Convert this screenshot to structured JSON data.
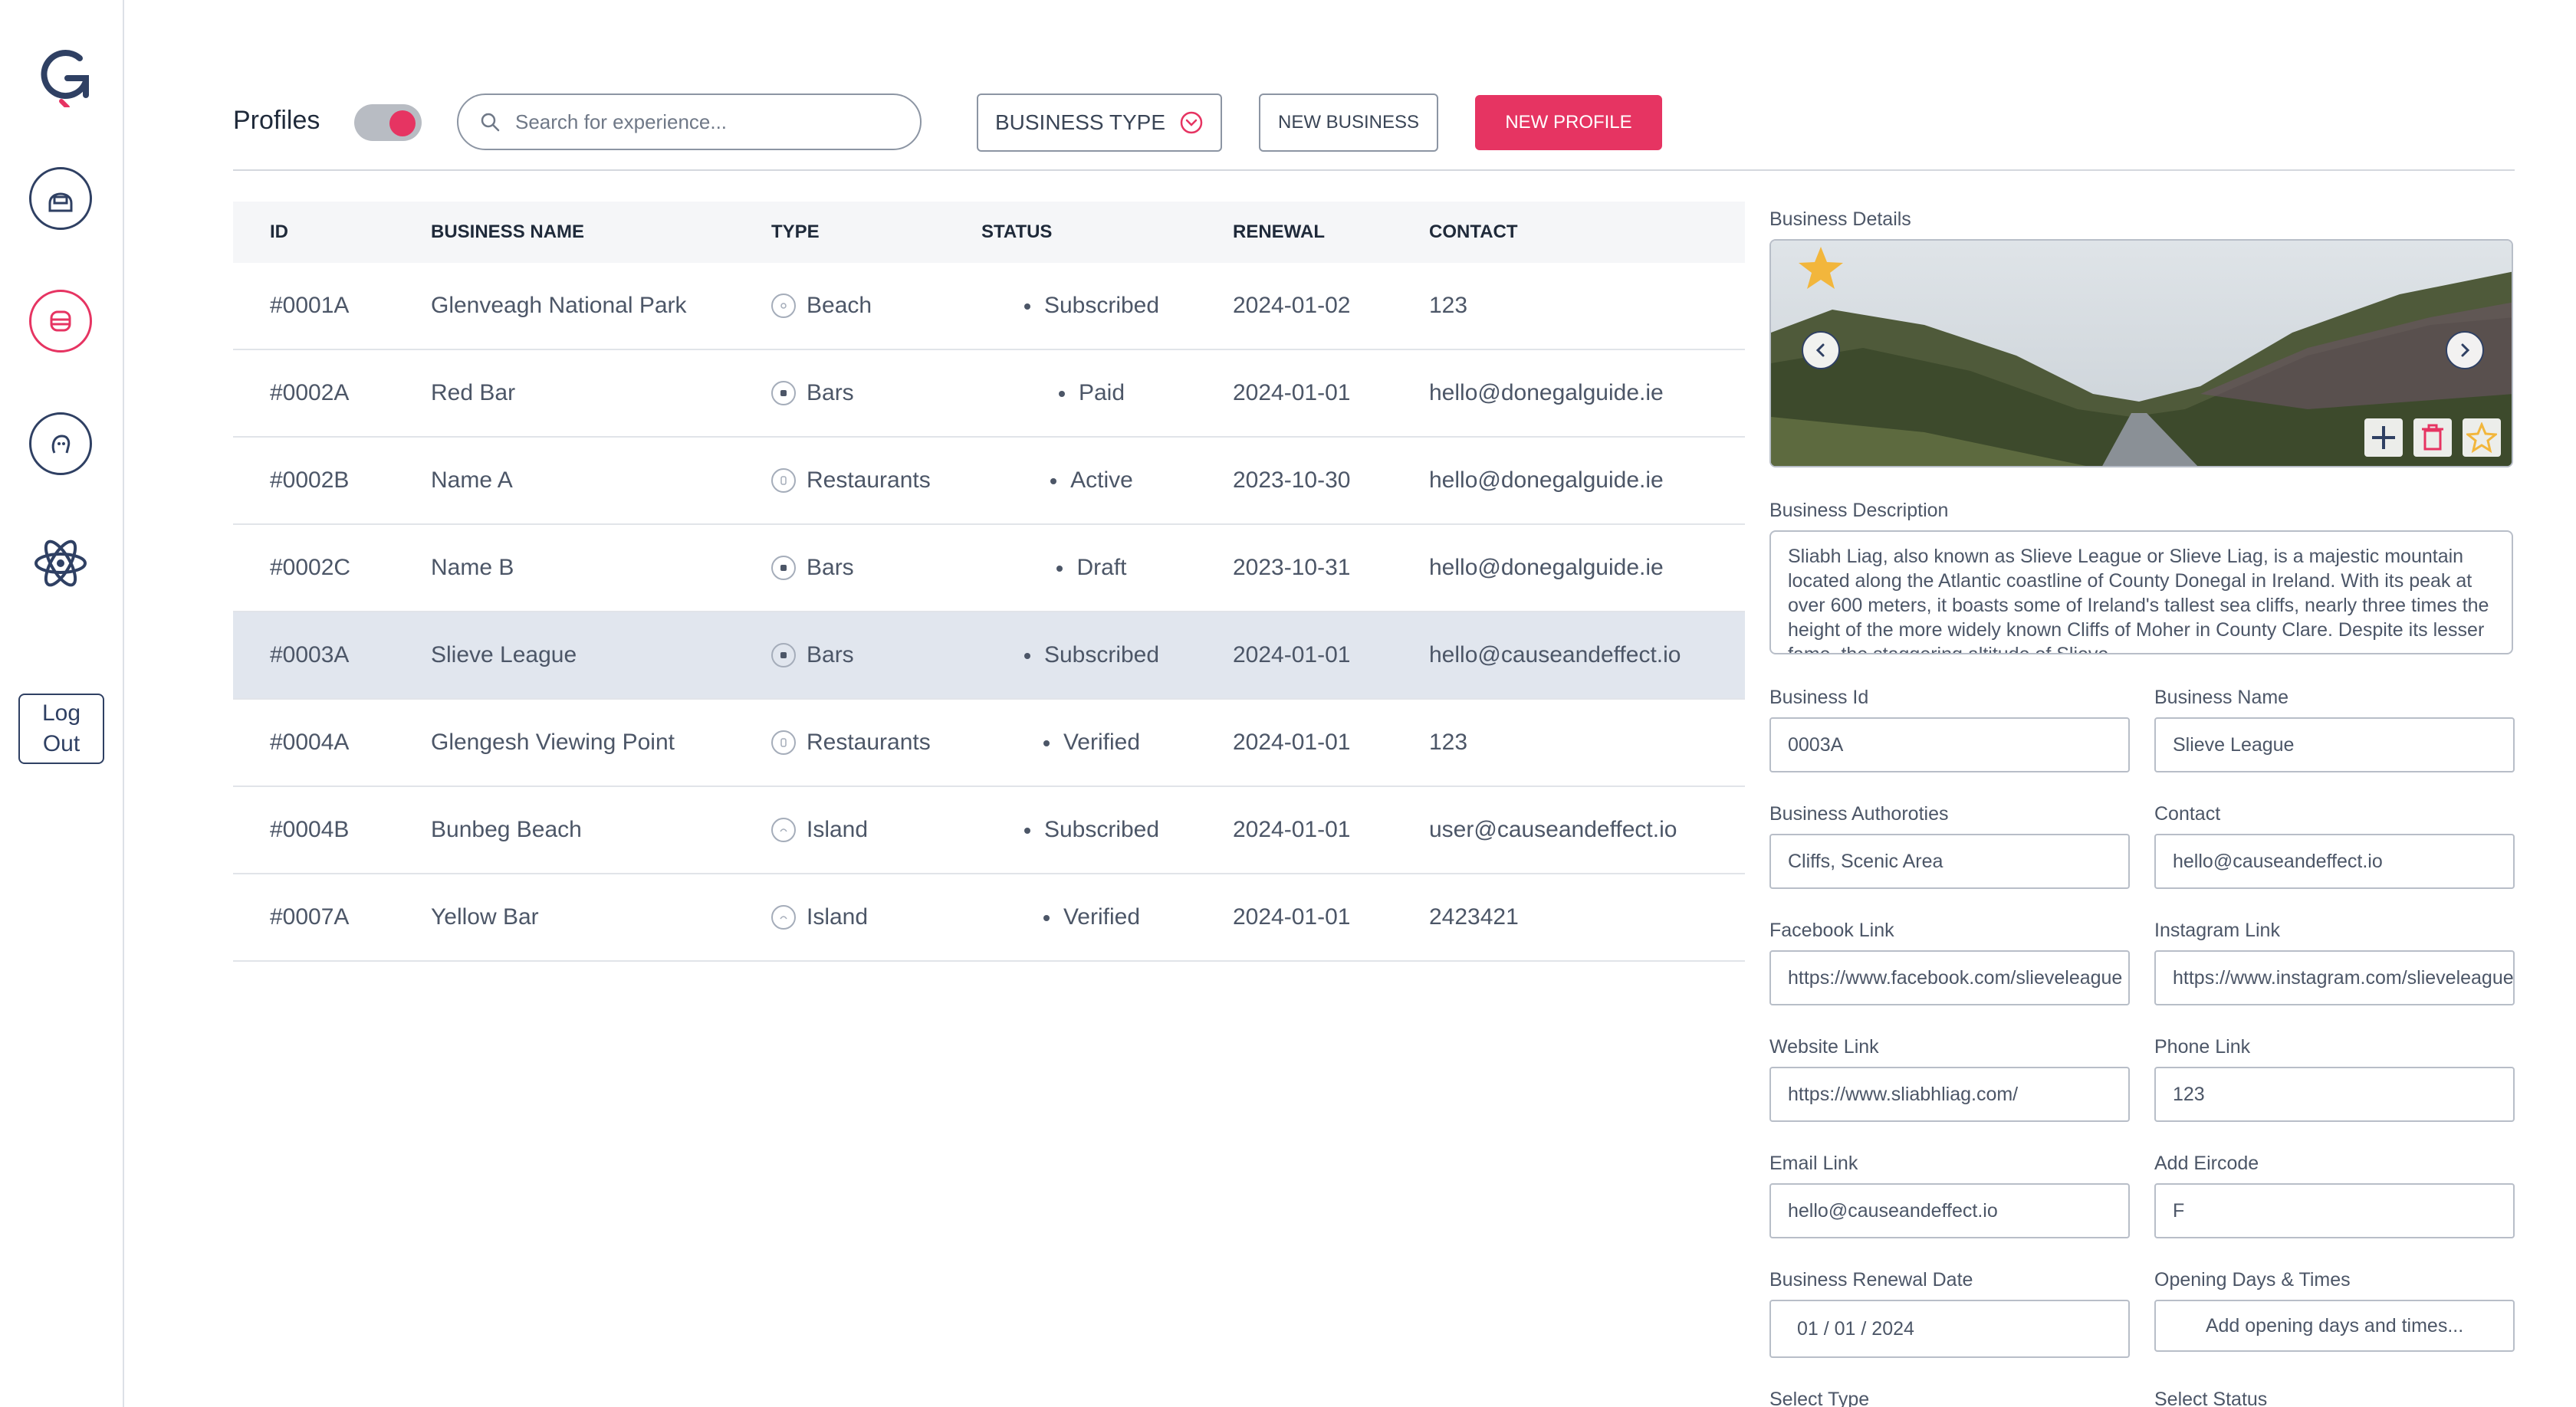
{
  "header": {
    "title": "Profiles",
    "search_placeholder": "Search for experience...",
    "business_type_label": "BUSINESS TYPE",
    "new_business_label": "NEW BUSINESS",
    "new_profile_label": "NEW PROFILE",
    "toggle_on": true
  },
  "sidebar": {
    "logout_line1": "Log",
    "logout_line2": "Out"
  },
  "table": {
    "columns": [
      "ID",
      "BUSINESS NAME",
      "TYPE",
      "STATUS",
      "RENEWAL",
      "CONTACT"
    ],
    "rows": [
      {
        "id": "#0001A",
        "name": "Glenveagh National Park",
        "type": "Beach",
        "status": "Subscribed",
        "renewal": "2024-01-02",
        "contact": "123"
      },
      {
        "id": "#0002A",
        "name": "Red Bar",
        "type": "Bars",
        "status": "Paid",
        "renewal": "2024-01-01",
        "contact": "hello@donegalguide.ie"
      },
      {
        "id": "#0002B",
        "name": "Name A",
        "type": "Restaurants",
        "status": "Active",
        "renewal": "2023-10-30",
        "contact": "hello@donegalguide.ie"
      },
      {
        "id": "#0002C",
        "name": "Name B",
        "type": "Bars",
        "status": "Draft",
        "renewal": "2023-10-31",
        "contact": "hello@donegalguide.ie"
      },
      {
        "id": "#0003A",
        "name": "Slieve League",
        "type": "Bars",
        "status": "Subscribed",
        "renewal": "2024-01-01",
        "contact": "hello@causeandeffect.io"
      },
      {
        "id": "#0004A",
        "name": "Glengesh Viewing Point",
        "type": "Restaurants",
        "status": "Verified",
        "renewal": "2024-01-01",
        "contact": "123"
      },
      {
        "id": "#0004B",
        "name": "Bunbeg Beach",
        "type": "Island",
        "status": "Subscribed",
        "renewal": "2024-01-01",
        "contact": "user@causeandeffect.io"
      },
      {
        "id": "#0007A",
        "name": "Yellow Bar",
        "type": "Island",
        "status": "Verified",
        "renewal": "2024-01-01",
        "contact": "2423421"
      }
    ]
  },
  "details": {
    "section_label": "Business Details",
    "description_label": "Business Description",
    "description": "Sliabh Liag, also known as Slieve League or Slieve Liag, is a majestic mountain located along the Atlantic coastline of County Donegal in Ireland. With its peak at over 600 meters, it boasts some of Ireland's tallest sea cliffs, nearly three times the height of the more widely known Cliffs of Moher in County Clare. Despite its lesser fame, the staggering altitude of Slieve",
    "business_id_label": "Business Id",
    "business_id": "0003A",
    "business_name_label": "Business Name",
    "business_name": "Slieve League",
    "authorities_label": "Business Authoroties",
    "authorities": "Cliffs, Scenic Area",
    "contact_label": "Contact",
    "contact": "hello@causeandeffect.io",
    "facebook_label": "Facebook Link",
    "facebook": "https://www.facebook.com/slieveleague",
    "instagram_label": "Instagram Link",
    "instagram": "https://www.instagram.com/slieveleague",
    "website_label": "Website Link",
    "website": "https://www.sliabhliag.com/",
    "phone_label": "Phone Link",
    "phone": "123",
    "email_label": "Email Link",
    "email": "hello@causeandeffect.io",
    "eircode_label": "Add Eircode",
    "eircode": "F",
    "renewal_label": "Business Renewal Date",
    "renewal": "01 / 01 / 2024",
    "opening_label": "Opening Days & Times",
    "opening_button": "Add opening days and times...",
    "select_type_label": "Select Type",
    "select_status_label": "Select Status"
  },
  "colors": {
    "accent": "#e63462",
    "navy": "#2f4063",
    "selected_row": "#e1e6ee"
  }
}
